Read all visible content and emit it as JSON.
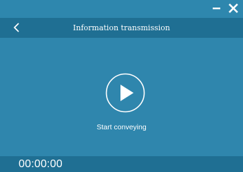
{
  "window": {
    "minimize_icon": "minimize-icon",
    "close_icon": "close-icon"
  },
  "header": {
    "back_icon": "chevron-left-icon",
    "title": "Information transmission"
  },
  "main": {
    "play_icon": "play-circle-icon",
    "status_label": "Start conveying"
  },
  "footer": {
    "timer": "00:00:00"
  },
  "colors": {
    "background": "#2f86ad",
    "bar": "#1f6f93",
    "foreground": "#ffffff"
  }
}
